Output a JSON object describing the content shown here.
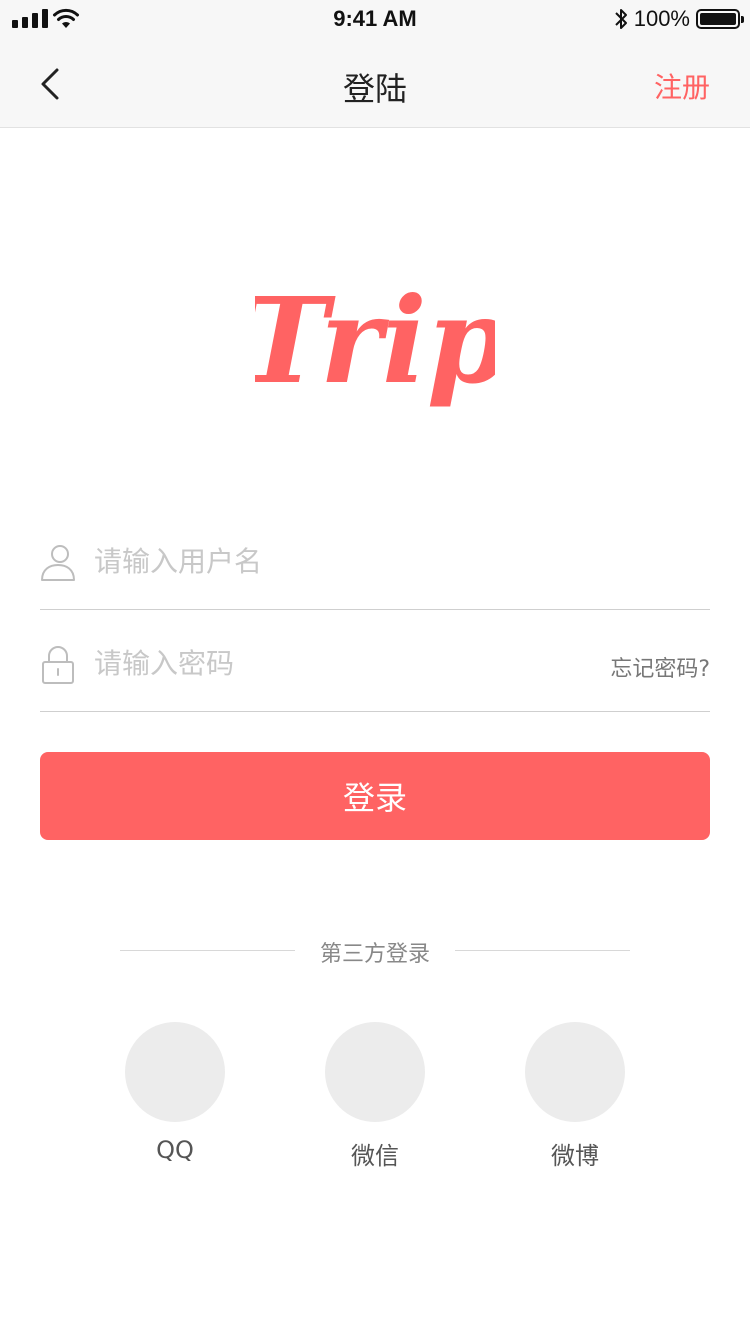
{
  "status_bar": {
    "time": "9:41 AM",
    "battery_text": "100%",
    "battery_level": 1.0
  },
  "nav": {
    "title": "登陆",
    "register_label": "注册",
    "back_icon": "chevron-left-icon"
  },
  "logo": {
    "text": "Trip",
    "color": "#ff6363"
  },
  "form": {
    "username_placeholder": "请输入用户名",
    "password_placeholder": "请输入密码",
    "forgot_label": "忘记密码?",
    "login_label": "登录"
  },
  "third_party": {
    "label": "第三方登录",
    "providers": [
      {
        "label": "QQ"
      },
      {
        "label": "微信"
      },
      {
        "label": "微博"
      }
    ]
  },
  "colors": {
    "accent": "#ff6363",
    "circle": "#ececec"
  }
}
